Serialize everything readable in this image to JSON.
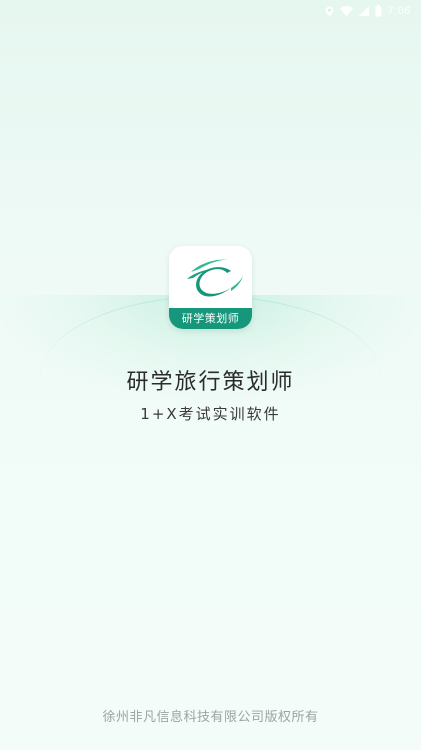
{
  "status_bar": {
    "time": "7:06",
    "icons": [
      "location-icon",
      "wifi-icon",
      "signal-icon",
      "battery-icon"
    ]
  },
  "logo": {
    "icon": "travel-c-logo-icon",
    "band_text": "研学策划师",
    "band_color": "#16977b"
  },
  "app": {
    "title": "研学旅行策划师",
    "subtitle": "1+X考试实训软件"
  },
  "footer": {
    "copyright": "徐州非凡信息科技有限公司版权所有"
  },
  "colors": {
    "accent": "#16977b",
    "accent_light": "#2dbb8f",
    "background": "#eaf8f2"
  }
}
